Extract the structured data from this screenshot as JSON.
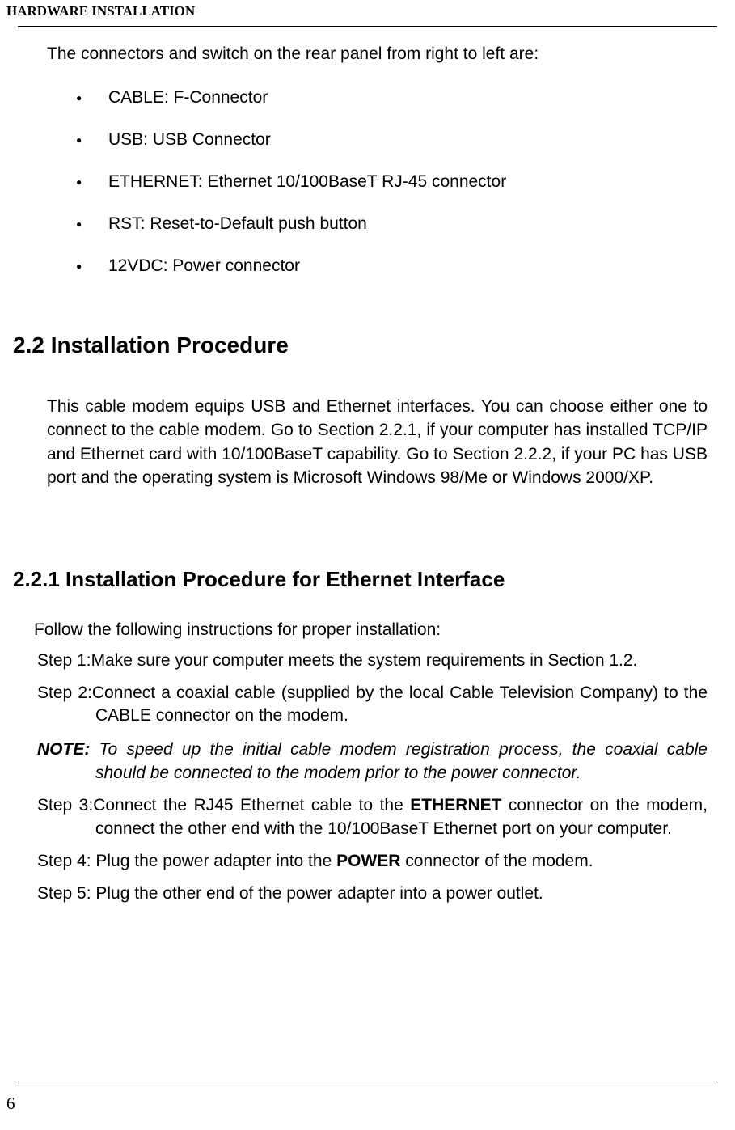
{
  "header": {
    "title": "HARDWARE INSTALLATION"
  },
  "intro": "The connectors and switch on the rear panel from right to left are:",
  "bullets": [
    "CABLE: F-Connector",
    "USB: USB Connector",
    "ETHERNET: Ethernet 10/100BaseT RJ-45 connector",
    "RST: Reset-to-Default push button",
    "12VDC: Power connector"
  ],
  "section22": {
    "heading": "2.2 Installation Procedure",
    "body": "This cable modem equips USB and Ethernet interfaces. You can choose either one to connect to the cable modem. Go to Section 2.2.1, if your computer has installed TCP/IP and Ethernet card with 10/100BaseT capability. Go to Section 2.2.2, if your PC has USB port and the operating system is Microsoft Windows 98/Me or Windows 2000/XP."
  },
  "section221": {
    "heading": "2.2.1 Installation Procedure for Ethernet Interface",
    "follow": "Follow the following instructions for proper installation:",
    "step1_prefix": "Step 1:",
    "step1_text": "Make sure your computer meets the system requirements in Section 1.2.",
    "step2_prefix": "Step 2:",
    "step2_text": "Connect a coaxial cable (supplied by the local Cable Television Company) to the CABLE connector on the modem.",
    "note_label": "NOTE:",
    "note_text": " To speed up the initial cable modem registration process, the coaxial cable should be connected to the modem prior to the power connector.",
    "step3_prefix": "Step 3:",
    "step3_text_a": "Connect the RJ45 Ethernet cable to the ",
    "step3_bold": "ETHERNET",
    "step3_text_b": " connector on the modem, connect the other end with the 10/100BaseT Ethernet port on your computer.",
    "step4_a": "Step 4: Plug the power adapter into the ",
    "step4_bold": "POWER",
    "step4_b": " connector of the modem.",
    "step5": "Step 5: Plug the other end of the power adapter into a power outlet."
  },
  "pageNumber": "6"
}
